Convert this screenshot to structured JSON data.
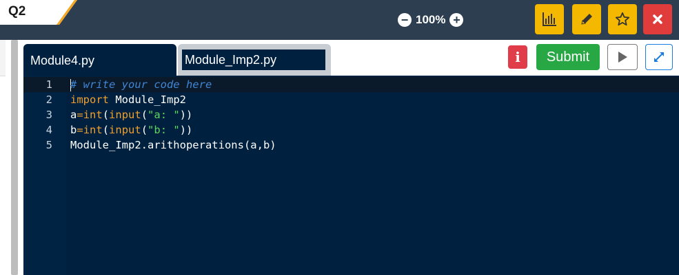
{
  "question_tab": {
    "label": "Q2"
  },
  "zoom": {
    "level": "100%",
    "minus_icon": "minus-circle-icon",
    "plus_icon": "plus-circle-icon"
  },
  "toolbar_icons": [
    "bar-chart-icon",
    "pencil-icon",
    "star-icon",
    "close-icon"
  ],
  "editor": {
    "tabs": [
      {
        "label": "Module4.py",
        "active": true
      },
      {
        "label": "Module_Imp2.py",
        "active": false
      }
    ],
    "info_label": "i",
    "submit_label": "Submit",
    "run_icon": "play-icon",
    "expand_icon": "expand-icon",
    "line_numbers": [
      "1",
      "2",
      "3",
      "4",
      "5"
    ],
    "code_lines": [
      "# write your code here",
      "import Module_Imp2",
      "a=int(input(\"a: \"))",
      "b=int(input(\"b: \"))",
      "Module_Imp2.arithoperations(a,b)"
    ]
  },
  "colors": {
    "topbar": "#2c3e50",
    "editor_bg": "#00203f",
    "yellow_button": "#f5b800",
    "red_button": "#e03c3c",
    "submit_green": "#28a745",
    "keyword": "#f0a030",
    "string": "#5cd65c",
    "comment": "#3f86d6"
  }
}
